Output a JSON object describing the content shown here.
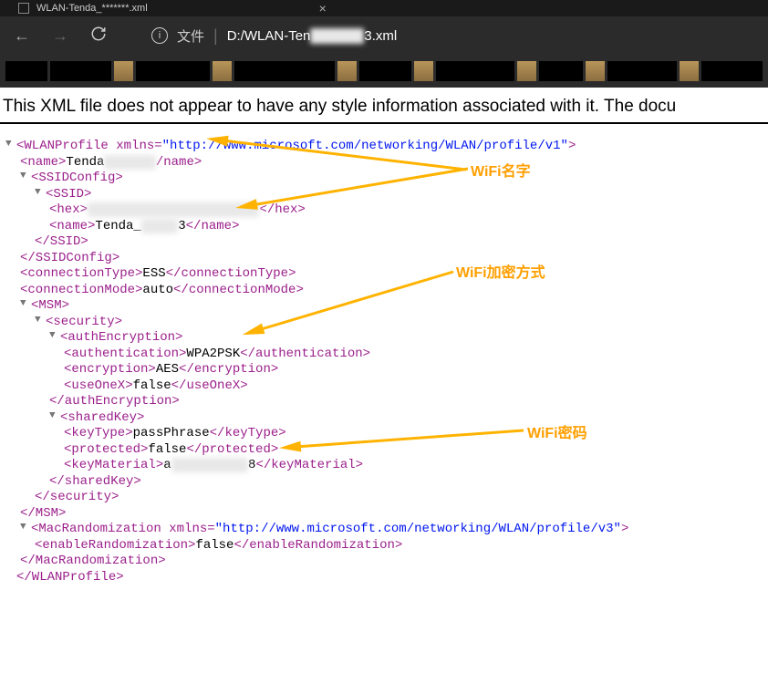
{
  "browser": {
    "tab_title": "WLAN-Tenda_*******.xml",
    "url_label": "文件",
    "url_path_prefix": "D:/WLAN-Ten",
    "url_path_suffix": "3.xml",
    "info_glyph": "i"
  },
  "page": {
    "no_style_message": "This XML file does not appear to have any style information associated with it. The docu"
  },
  "xml": {
    "root_tag": "WLANProfile",
    "root_xmlns_attr": "xmlns",
    "root_xmlns_val": "\"http://www.microsoft.com/networking/WLAN/profile/v1\"",
    "name_tag": "name",
    "name_open": "<name>",
    "name_close": "/name>",
    "name_val_prefix": "Tenda",
    "ssid_config_open": "<SSIDConfig>",
    "ssid_config_close": "</SSIDConfig>",
    "ssid_open": "<SSID>",
    "ssid_close": "</SSID>",
    "hex_open": "<hex>",
    "hex_close": "</hex>",
    "ssid_name_val_prefix": "Tenda_",
    "ssid_name_val_suffix": "3",
    "ssid_name_close": "</name>",
    "conn_type_open": "<connectionType>",
    "conn_type_val": "ESS",
    "conn_type_close": "</connectionType>",
    "conn_mode_open": "<connectionMode>",
    "conn_mode_val": "auto",
    "conn_mode_close": "</connectionMode>",
    "msm_open": "<MSM>",
    "msm_close": "</MSM>",
    "security_open": "<security>",
    "security_close": "</security>",
    "auth_enc_open": "<authEncryption>",
    "auth_enc_close": "</authEncryption>",
    "auth_open": "<authentication>",
    "auth_val": "WPA2PSK",
    "auth_close": "</authentication>",
    "enc_open": "<encryption>",
    "enc_val": "AES",
    "enc_close": "</encryption>",
    "useonex_open": "<useOneX>",
    "useonex_val": "false",
    "useonex_close": "</useOneX>",
    "shared_key_open": "<sharedKey>",
    "shared_key_close": "</sharedKey>",
    "keytype_open": "<keyType>",
    "keytype_val": "passPhrase",
    "keytype_close": "</keyType>",
    "protected_open": "<protected>",
    "protected_val": "false",
    "protected_close": "</protected>",
    "keymat_open": "<keyMaterial>",
    "keymat_val_prefix": "a",
    "keymat_val_suffix": "8",
    "keymat_close": "</keyMaterial>",
    "mac_rand_tag": "MacRandomization",
    "mac_rand_xmlns_val": "\"http://www.microsoft.com/networking/WLAN/profile/v3\"",
    "mac_rand_close": "</MacRandomization>",
    "enable_rand_open": "<enableRandomization>",
    "enable_rand_val": "false",
    "enable_rand_close": "</enableRandomization>",
    "root_close": "</WLANProfile>"
  },
  "annotations": {
    "wifi_name": "WiFi名字",
    "wifi_encryption": "WiFi加密方式",
    "wifi_password": "WiFi密码"
  },
  "colors": {
    "arrow": "#ffb300",
    "annotation_text": "#ff9f00"
  },
  "glyphs": {
    "triangle": "▼",
    "back": "←",
    "forward": "→",
    "close": "×"
  }
}
